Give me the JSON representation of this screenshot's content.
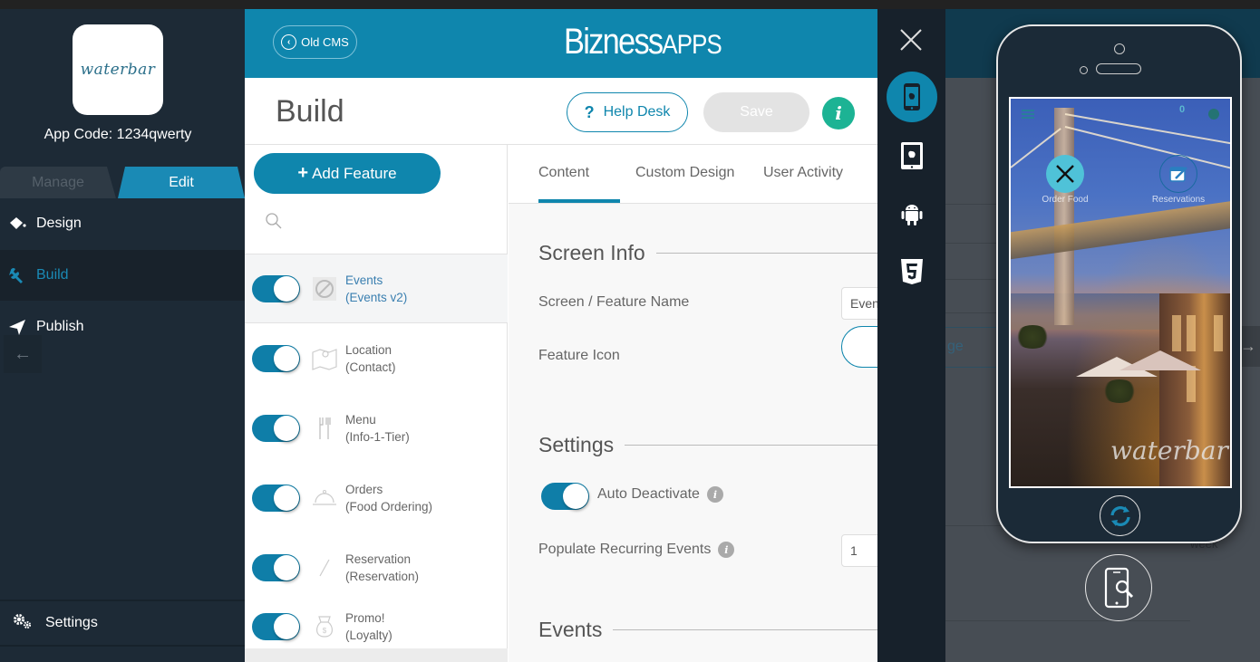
{
  "sidebar": {
    "app_logo_text": "waterbar",
    "app_code": "App Code: 1234qwerty",
    "mode_tabs": [
      {
        "label": "Manage",
        "active": false
      },
      {
        "label": "Edit",
        "active": true
      }
    ],
    "nav": [
      {
        "label": "Design",
        "icon": "paint-bucket-icon",
        "active": false
      },
      {
        "label": "Build",
        "icon": "wrench-icon",
        "active": true
      },
      {
        "label": "Publish",
        "icon": "paper-plane-icon",
        "active": false
      }
    ],
    "back_icon": "arrow-left-icon",
    "settings_label": "Settings"
  },
  "header": {
    "old_cms_label": "Old CMS",
    "brand_main": "Bizness",
    "brand_suffix": "APPS",
    "page_title": "Build",
    "help_label": "Help Desk",
    "help_glyph": "?",
    "save_label": "Save",
    "info_glyph": "i"
  },
  "features": {
    "add_label": "Add Feature",
    "add_glyph": "+",
    "items": [
      {
        "name": "Events",
        "type": "(Events v2)",
        "enabled": true,
        "selected": true,
        "icon": "events-icon"
      },
      {
        "name": "Location",
        "type": "(Contact)",
        "enabled": true,
        "selected": false,
        "icon": "map-pin-icon"
      },
      {
        "name": "Menu",
        "type": "(Info-1-Tier)",
        "enabled": true,
        "selected": false,
        "icon": "fork-knife-icon"
      },
      {
        "name": "Orders",
        "type": "(Food Ordering)",
        "enabled": true,
        "selected": false,
        "icon": "cloche-icon"
      },
      {
        "name": "Reservation",
        "type": "(Reservation)",
        "enabled": true,
        "selected": false,
        "icon": "pen-icon"
      },
      {
        "name": "Promo!",
        "type": "(Loyalty)",
        "enabled": true,
        "selected": false,
        "icon": "money-bag-icon"
      }
    ]
  },
  "content": {
    "tabs": [
      {
        "label": "Content",
        "active": true
      },
      {
        "label": "Custom Design",
        "active": false
      },
      {
        "label": "User Activity",
        "active": false
      }
    ],
    "screen_info_title": "Screen Info",
    "feature_name_label": "Screen / Feature Name",
    "feature_name_value": "Events",
    "feature_icon_label": "Feature Icon",
    "settings_title": "Settings",
    "auto_deactivate_label": "Auto Deactivate",
    "auto_deactivate_on": true,
    "recurring_label": "Populate Recurring Events",
    "recurring_value": "1",
    "events_title": "Events"
  },
  "preview": {
    "devices": [
      {
        "name": "iphone",
        "active": true
      },
      {
        "name": "ipad",
        "active": false
      },
      {
        "name": "android",
        "active": false
      },
      {
        "name": "html5",
        "active": false
      }
    ],
    "phone": {
      "badge_count": "0",
      "tiles": [
        {
          "label": "Order Food",
          "icon": "fork-knife-cross-icon"
        },
        {
          "label": "Reservations",
          "icon": "calendar-edit-icon"
        }
      ],
      "logo_text": "waterbar"
    },
    "background_ghost_text": "ge",
    "background_ghost_text_2": "week"
  },
  "colors": {
    "accent": "#0f86ad",
    "sidebar_bg": "#1d2a36",
    "info_green": "#1cb394"
  }
}
